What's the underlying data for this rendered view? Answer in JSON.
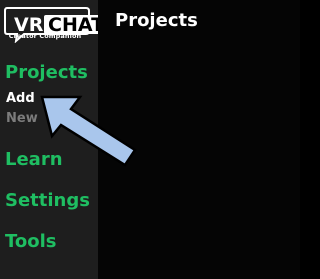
{
  "logo": {
    "vr": "VR",
    "chat": "CHAT",
    "subtitle": "Creator Companion"
  },
  "sidebar": {
    "items": [
      {
        "label": "Projects"
      },
      {
        "label": "Add"
      },
      {
        "label": "New"
      },
      {
        "label": "Learn"
      },
      {
        "label": "Settings"
      },
      {
        "label": "Tools"
      }
    ]
  },
  "main": {
    "title": "Projects"
  },
  "colors": {
    "accent": "#1fbe62",
    "sidebar_bg": "#1e1e1e",
    "main_bg": "#050505",
    "arrow": "#a9c6ec",
    "disabled": "#7c7c7c"
  },
  "icons": {
    "pointer": "arrow-pointer-icon"
  }
}
